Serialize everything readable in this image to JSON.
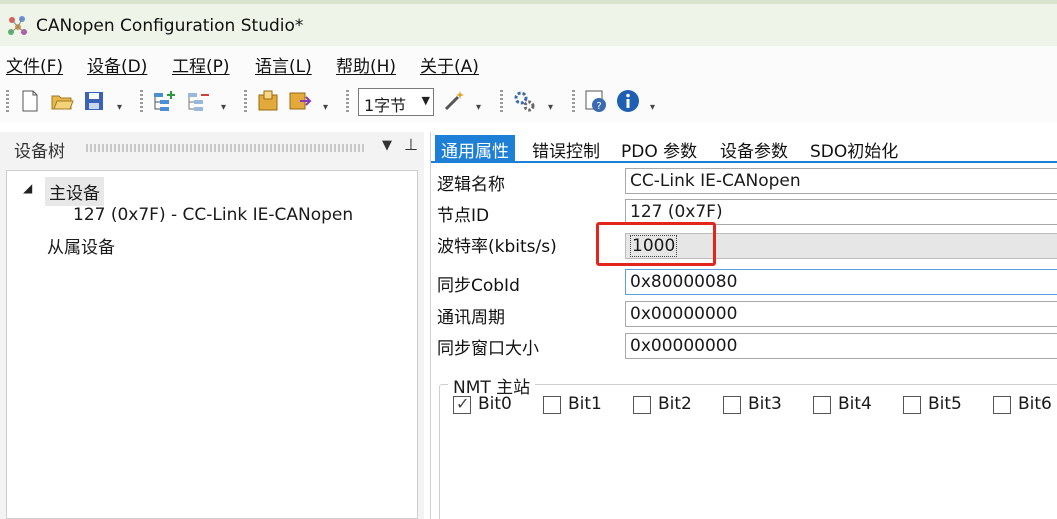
{
  "window": {
    "title": "CANopen Configuration Studio*"
  },
  "menu": [
    {
      "label": "文件(F)"
    },
    {
      "label": "设备(D)"
    },
    {
      "label": "工程(P)"
    },
    {
      "label": "语言(L)"
    },
    {
      "label": "帮助(H)"
    },
    {
      "label": "关于(A)"
    }
  ],
  "toolbar": {
    "byte_select": "1字节",
    "icons": [
      "new-file-icon",
      "open-folder-icon",
      "save-icon",
      "add-device-icon",
      "remove-device-icon",
      "import-icon",
      "export-icon",
      "wand-icon",
      "settings-icon",
      "help-icon",
      "info-icon"
    ]
  },
  "left_pane": {
    "title": "设备树",
    "tree": {
      "root": "主设备",
      "child": "127 (0x7F)  -  CC-Link IE-CANopen",
      "slave": "从属设备"
    }
  },
  "tabs": [
    {
      "label": "通用属性",
      "active": true
    },
    {
      "label": "错误控制"
    },
    {
      "label": "PDO 参数"
    },
    {
      "label": "设备参数"
    },
    {
      "label": "SDO初始化"
    }
  ],
  "properties": [
    {
      "label": "逻辑名称",
      "value": "CC-Link IE-CANopen"
    },
    {
      "label": "节点ID",
      "value": "127 (0x7F)"
    },
    {
      "label": "波特率(kbits/s)",
      "value": "1000"
    },
    {
      "label": "同步CobId",
      "value": "0x80000080"
    },
    {
      "label": "通讯周期",
      "value": "0x00000000"
    },
    {
      "label": "同步窗口大小",
      "value": "0x00000000"
    }
  ],
  "nmt_master": {
    "title": "NMT 主站",
    "bits": [
      {
        "label": "Bit0",
        "checked": true
      },
      {
        "label": "Bit1",
        "checked": false
      },
      {
        "label": "Bit2",
        "checked": false
      },
      {
        "label": "Bit3",
        "checked": false
      },
      {
        "label": "Bit4",
        "checked": false
      },
      {
        "label": "Bit5",
        "checked": false
      },
      {
        "label": "Bit6",
        "checked": false
      }
    ]
  },
  "colors": {
    "accent": "#1e7fd6",
    "highlight_box": "#e2261c",
    "titlebar_bg": "#eef5e8"
  }
}
